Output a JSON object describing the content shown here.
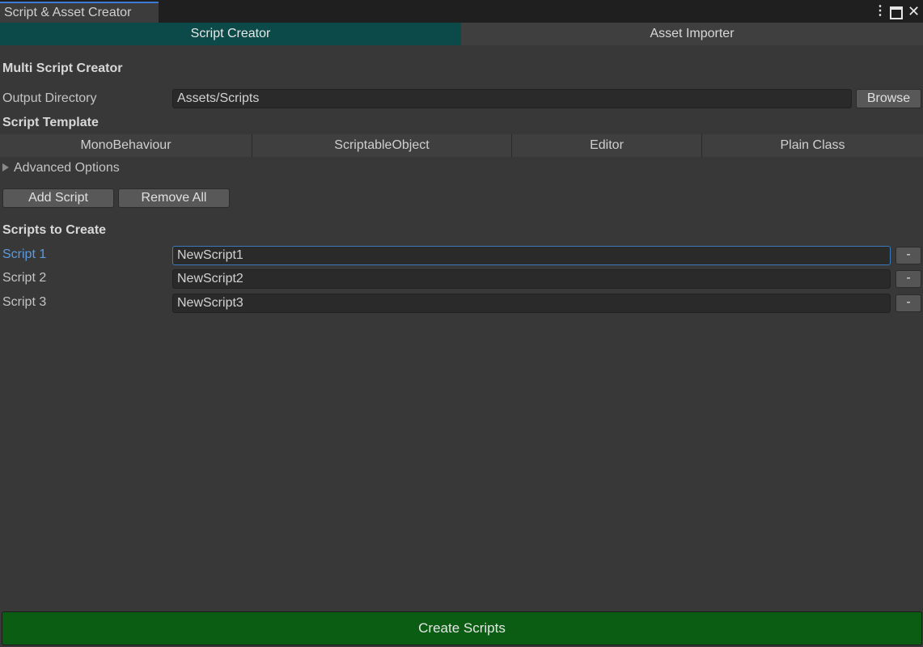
{
  "window": {
    "tab_title": "Script & Asset Creator",
    "controls": {
      "menu_icon": "kebab-menu-icon",
      "maximize_icon": "maximize-icon",
      "close_icon": "close-icon",
      "menu_glyph": "⋮",
      "close_glyph": "✕"
    }
  },
  "mode_tabs": [
    {
      "label": "Script Creator",
      "active": true
    },
    {
      "label": "Asset Importer",
      "active": false
    }
  ],
  "colors": {
    "active_tab": "#0b4a48",
    "create_button": "#0a5d12",
    "focus_label": "#5b9be0"
  },
  "main": {
    "heading": "Multi Script Creator",
    "output_directory": {
      "label": "Output Directory",
      "value": "Assets/Scripts",
      "browse_label": "Browse"
    },
    "template_heading": "Script Template",
    "templates": [
      "MonoBehaviour",
      "ScriptableObject",
      "Editor",
      "Plain Class"
    ],
    "advanced_options_label": "Advanced Options",
    "add_script_label": "Add Script",
    "remove_all_label": "Remove All",
    "scripts_heading": "Scripts to Create",
    "scripts": [
      {
        "label": "Script 1",
        "value": "NewScript1",
        "focused": true
      },
      {
        "label": "Script 2",
        "value": "NewScript2",
        "focused": false
      },
      {
        "label": "Script 3",
        "value": "NewScript3",
        "focused": false
      }
    ],
    "remove_row_label": "-",
    "create_label": "Create Scripts"
  }
}
